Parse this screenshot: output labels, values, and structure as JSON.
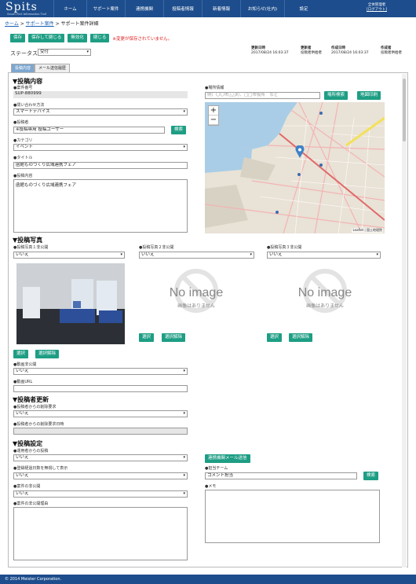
{
  "header": {
    "logo": "Spits",
    "logo_sub": "Smart Port Information Tool",
    "nav": [
      "ホーム",
      "サポート案件",
      "連携機関",
      "投稿者情報",
      "新着情報",
      "お知らせ(社内)",
      "設定"
    ],
    "user_name": "全体管理者",
    "logout": "[ログアウト]"
  },
  "breadcrumb": {
    "home": "ホーム",
    "support": "サポート案件",
    "current": " > サポート案件詳細",
    "sep": " > "
  },
  "toolbar": {
    "save": "保存",
    "save_close": "保存して閉じる",
    "disable": "無効化",
    "close": "閉じる",
    "warning": "※変更が保存されていません。"
  },
  "status": {
    "label": "ステータス",
    "value": "受付"
  },
  "meta": [
    {
      "k": "更新日時",
      "v": "2017/08/24 16:03:37"
    },
    {
      "k": "更新者",
      "v": "投稿者供給者"
    },
    {
      "k": "作成日時",
      "v": "2017/08/24 16:03:37"
    },
    {
      "k": "作成者",
      "v": "投稿者供給者"
    }
  ],
  "tabs": [
    "投稿内容",
    "メール送信履歴"
  ],
  "post": {
    "section": "▼投稿内容",
    "no_label": "●案件番号",
    "no_value": "SUP-880999",
    "inquiry_label": "●問い合わせ方法",
    "inquiry_value": "スマートデバイス",
    "poster_label": "●投稿者",
    "poster_value": "※投稿専用 投稿ユーザー",
    "search": "検索",
    "category_label": "●カテゴリ",
    "category_value": "イベント",
    "title_label": "●タイトル",
    "title_value": "函館ものづくり広域連携フェア",
    "content_label": "●投稿内容",
    "content_value": "函館ものづくり広域連携フェア"
  },
  "location": {
    "label": "●場所情報",
    "placeholder": "例）〇〇市△△町、□□市役所　など",
    "search": "場所検索",
    "print": "地図印刷",
    "attribution": "Leaflet | 国土地理院",
    "zoom_in": "+",
    "zoom_out": "−"
  },
  "photos": {
    "section": "▼投稿写真",
    "p1_label": "●投稿写真１非公開",
    "p2_label": "●投稿写真２非公開",
    "p3_label": "●投稿写真３非公開",
    "value": "いいえ",
    "noimage": "No image",
    "noimage_sub": "画像はありません",
    "select": "選択",
    "release": "選択解除"
  },
  "video": {
    "private_label": "●動画非公開",
    "private_value": "いいえ",
    "url_label": "●動画URL"
  },
  "update": {
    "section": "▼投稿者更新",
    "del_label": "●投稿者からの削除要求",
    "del_value": "いいえ",
    "del_date_label": "●投稿者からの削除要求日時"
  },
  "settings": {
    "section": "▼投稿設定",
    "ops_label": "●運用者からの投稿",
    "ops_value": "いいえ",
    "reg_label": "●登録経過日数を無視して表示",
    "reg_value": "いいえ",
    "hide_label": "●案件の非公開",
    "hide_value": "いいえ",
    "reason_label": "●案件の非公開理由",
    "mail_button": "連携機関メール送信",
    "team_label": "●担当チーム",
    "team_value": "コメント担当",
    "team_search": "検索",
    "memo_label": "●メモ"
  },
  "footer": "© 2014 Meister Corporation."
}
